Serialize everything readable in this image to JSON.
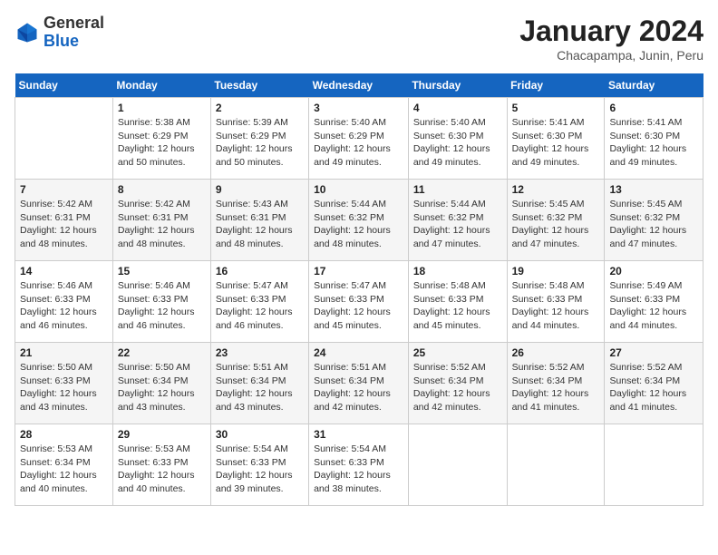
{
  "header": {
    "logo_general": "General",
    "logo_blue": "Blue",
    "month_year": "January 2024",
    "location": "Chacapampa, Junin, Peru"
  },
  "days_of_week": [
    "Sunday",
    "Monday",
    "Tuesday",
    "Wednesday",
    "Thursday",
    "Friday",
    "Saturday"
  ],
  "weeks": [
    [
      {
        "day": "",
        "info": ""
      },
      {
        "day": "1",
        "info": "Sunrise: 5:38 AM\nSunset: 6:29 PM\nDaylight: 12 hours\nand 50 minutes."
      },
      {
        "day": "2",
        "info": "Sunrise: 5:39 AM\nSunset: 6:29 PM\nDaylight: 12 hours\nand 50 minutes."
      },
      {
        "day": "3",
        "info": "Sunrise: 5:40 AM\nSunset: 6:29 PM\nDaylight: 12 hours\nand 49 minutes."
      },
      {
        "day": "4",
        "info": "Sunrise: 5:40 AM\nSunset: 6:30 PM\nDaylight: 12 hours\nand 49 minutes."
      },
      {
        "day": "5",
        "info": "Sunrise: 5:41 AM\nSunset: 6:30 PM\nDaylight: 12 hours\nand 49 minutes."
      },
      {
        "day": "6",
        "info": "Sunrise: 5:41 AM\nSunset: 6:30 PM\nDaylight: 12 hours\nand 49 minutes."
      }
    ],
    [
      {
        "day": "7",
        "info": "Sunrise: 5:42 AM\nSunset: 6:31 PM\nDaylight: 12 hours\nand 48 minutes."
      },
      {
        "day": "8",
        "info": "Sunrise: 5:42 AM\nSunset: 6:31 PM\nDaylight: 12 hours\nand 48 minutes."
      },
      {
        "day": "9",
        "info": "Sunrise: 5:43 AM\nSunset: 6:31 PM\nDaylight: 12 hours\nand 48 minutes."
      },
      {
        "day": "10",
        "info": "Sunrise: 5:44 AM\nSunset: 6:32 PM\nDaylight: 12 hours\nand 48 minutes."
      },
      {
        "day": "11",
        "info": "Sunrise: 5:44 AM\nSunset: 6:32 PM\nDaylight: 12 hours\nand 47 minutes."
      },
      {
        "day": "12",
        "info": "Sunrise: 5:45 AM\nSunset: 6:32 PM\nDaylight: 12 hours\nand 47 minutes."
      },
      {
        "day": "13",
        "info": "Sunrise: 5:45 AM\nSunset: 6:32 PM\nDaylight: 12 hours\nand 47 minutes."
      }
    ],
    [
      {
        "day": "14",
        "info": "Sunrise: 5:46 AM\nSunset: 6:33 PM\nDaylight: 12 hours\nand 46 minutes."
      },
      {
        "day": "15",
        "info": "Sunrise: 5:46 AM\nSunset: 6:33 PM\nDaylight: 12 hours\nand 46 minutes."
      },
      {
        "day": "16",
        "info": "Sunrise: 5:47 AM\nSunset: 6:33 PM\nDaylight: 12 hours\nand 46 minutes."
      },
      {
        "day": "17",
        "info": "Sunrise: 5:47 AM\nSunset: 6:33 PM\nDaylight: 12 hours\nand 45 minutes."
      },
      {
        "day": "18",
        "info": "Sunrise: 5:48 AM\nSunset: 6:33 PM\nDaylight: 12 hours\nand 45 minutes."
      },
      {
        "day": "19",
        "info": "Sunrise: 5:48 AM\nSunset: 6:33 PM\nDaylight: 12 hours\nand 44 minutes."
      },
      {
        "day": "20",
        "info": "Sunrise: 5:49 AM\nSunset: 6:33 PM\nDaylight: 12 hours\nand 44 minutes."
      }
    ],
    [
      {
        "day": "21",
        "info": "Sunrise: 5:50 AM\nSunset: 6:33 PM\nDaylight: 12 hours\nand 43 minutes."
      },
      {
        "day": "22",
        "info": "Sunrise: 5:50 AM\nSunset: 6:34 PM\nDaylight: 12 hours\nand 43 minutes."
      },
      {
        "day": "23",
        "info": "Sunrise: 5:51 AM\nSunset: 6:34 PM\nDaylight: 12 hours\nand 43 minutes."
      },
      {
        "day": "24",
        "info": "Sunrise: 5:51 AM\nSunset: 6:34 PM\nDaylight: 12 hours\nand 42 minutes."
      },
      {
        "day": "25",
        "info": "Sunrise: 5:52 AM\nSunset: 6:34 PM\nDaylight: 12 hours\nand 42 minutes."
      },
      {
        "day": "26",
        "info": "Sunrise: 5:52 AM\nSunset: 6:34 PM\nDaylight: 12 hours\nand 41 minutes."
      },
      {
        "day": "27",
        "info": "Sunrise: 5:52 AM\nSunset: 6:34 PM\nDaylight: 12 hours\nand 41 minutes."
      }
    ],
    [
      {
        "day": "28",
        "info": "Sunrise: 5:53 AM\nSunset: 6:34 PM\nDaylight: 12 hours\nand 40 minutes."
      },
      {
        "day": "29",
        "info": "Sunrise: 5:53 AM\nSunset: 6:33 PM\nDaylight: 12 hours\nand 40 minutes."
      },
      {
        "day": "30",
        "info": "Sunrise: 5:54 AM\nSunset: 6:33 PM\nDaylight: 12 hours\nand 39 minutes."
      },
      {
        "day": "31",
        "info": "Sunrise: 5:54 AM\nSunset: 6:33 PM\nDaylight: 12 hours\nand 38 minutes."
      },
      {
        "day": "",
        "info": ""
      },
      {
        "day": "",
        "info": ""
      },
      {
        "day": "",
        "info": ""
      }
    ]
  ]
}
